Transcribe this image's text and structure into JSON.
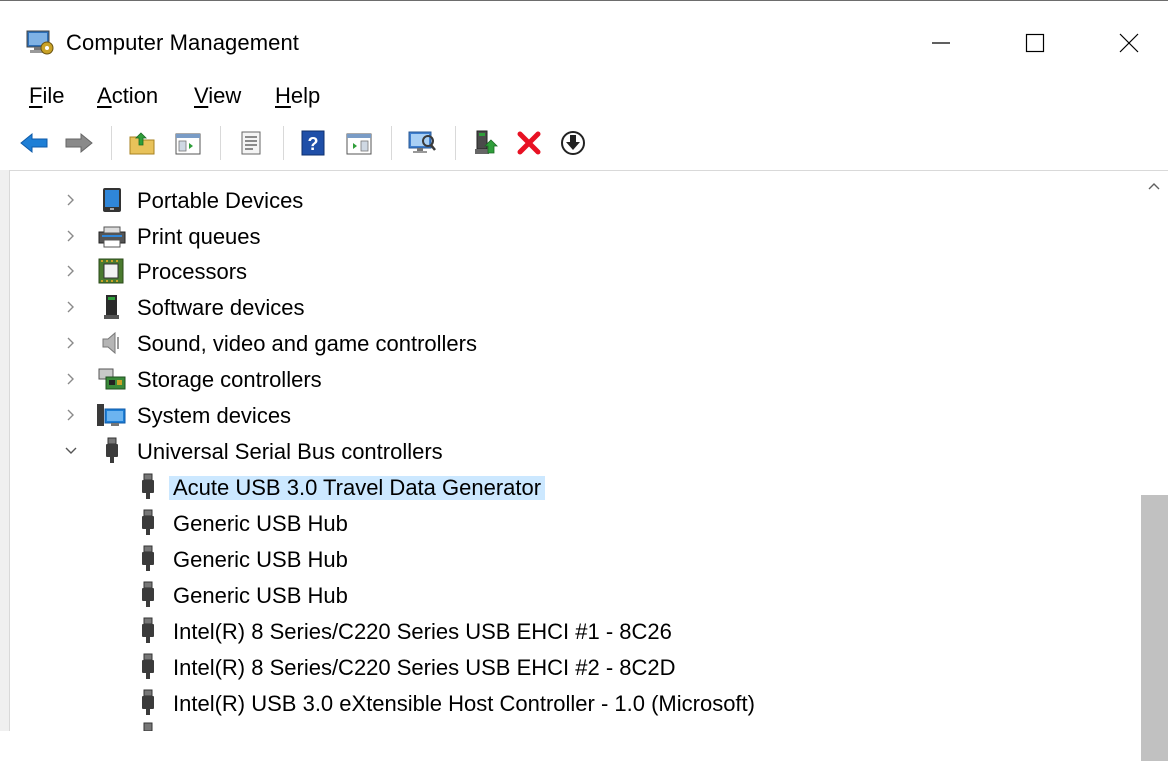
{
  "window": {
    "title": "Computer Management",
    "controls": {
      "minimize": "minimize",
      "maximize": "maximize",
      "close": "close"
    }
  },
  "menu": [
    {
      "label": "File",
      "accel": "F",
      "rest": "ile"
    },
    {
      "label": "Action",
      "accel": "A",
      "rest": "ction"
    },
    {
      "label": "View",
      "accel": "V",
      "rest": "iew"
    },
    {
      "label": "Help",
      "accel": "H",
      "rest": "elp"
    }
  ],
  "toolbar": {
    "buttons": [
      "back-icon",
      "forward-icon",
      "up-folder-icon",
      "show-hide-console-tree-icon",
      "properties-icon",
      "help-icon",
      "show-hide-action-pane-icon",
      "scan-hardware-icon",
      "update-driver-icon",
      "uninstall-device-icon",
      "disable-device-icon"
    ]
  },
  "tree": {
    "items": [
      {
        "label": "Portable Devices",
        "icon": "portable-device-icon",
        "level": 1,
        "expanded": false
      },
      {
        "label": "Print queues",
        "icon": "printer-icon",
        "level": 1,
        "expanded": false
      },
      {
        "label": "Processors",
        "icon": "processor-icon",
        "level": 1,
        "expanded": false
      },
      {
        "label": "Software devices",
        "icon": "software-device-icon",
        "level": 1,
        "expanded": false
      },
      {
        "label": "Sound, video and game controllers",
        "icon": "speaker-icon",
        "level": 1,
        "expanded": false
      },
      {
        "label": "Storage controllers",
        "icon": "storage-controller-icon",
        "level": 1,
        "expanded": false
      },
      {
        "label": "System devices",
        "icon": "system-device-icon",
        "level": 1,
        "expanded": false
      },
      {
        "label": "Universal Serial Bus controllers",
        "icon": "usb-icon",
        "level": 1,
        "expanded": true
      },
      {
        "label": "Acute USB 3.0 Travel Data Generator",
        "icon": "usb-icon",
        "level": 2,
        "selected": true
      },
      {
        "label": "Generic USB Hub",
        "icon": "usb-icon",
        "level": 2
      },
      {
        "label": "Generic USB Hub",
        "icon": "usb-icon",
        "level": 2
      },
      {
        "label": "Generic USB Hub",
        "icon": "usb-icon",
        "level": 2
      },
      {
        "label": "Intel(R) 8 Series/C220 Series USB EHCI #1 - 8C26",
        "icon": "usb-icon",
        "level": 2
      },
      {
        "label": "Intel(R) 8 Series/C220 Series USB EHCI #2 - 8C2D",
        "icon": "usb-icon",
        "level": 2
      },
      {
        "label": "Intel(R) USB 3.0 eXtensible Host Controller - 1.0 (Microsoft)",
        "icon": "usb-icon",
        "level": 2
      }
    ]
  },
  "colors": {
    "selection": "#cce8ff",
    "scroll_thumb": "#c1c1c1",
    "accent_blue": "#1e7fd6",
    "delete_red": "#e81123"
  },
  "scrollbar": {
    "position_fraction": 0.52,
    "visible_fraction": 0.48
  }
}
